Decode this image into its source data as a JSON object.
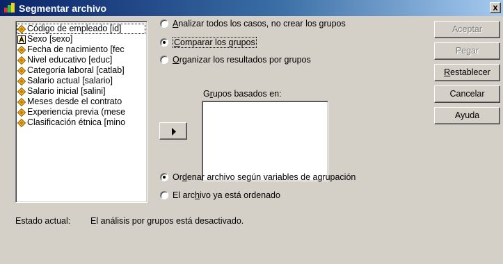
{
  "window": {
    "title": "Segmentar archivo",
    "close_label": "x"
  },
  "variables": [
    {
      "label": "Código de empleado [id]",
      "icon": "scale-variable-icon",
      "selected": true
    },
    {
      "label": "Sexo [sexo]",
      "icon": "nominal-string-variable-icon"
    },
    {
      "label": "Fecha de nacimiento [fec",
      "icon": "scale-variable-icon"
    },
    {
      "label": "Nivel educativo [educ]",
      "icon": "scale-variable-icon"
    },
    {
      "label": "Categoría laboral [catlab]",
      "icon": "scale-variable-icon"
    },
    {
      "label": "Salario actual [salario]",
      "icon": "scale-variable-icon"
    },
    {
      "label": "Salario inicial [salini]",
      "icon": "scale-variable-icon"
    },
    {
      "label": "Meses desde el contrato",
      "icon": "scale-variable-icon"
    },
    {
      "label": "Experiencia previa (mese",
      "icon": "scale-variable-icon"
    },
    {
      "label": "Clasificación étnica [mino",
      "icon": "scale-variable-icon"
    }
  ],
  "analysis_options": [
    {
      "accel": "A",
      "rest": "nalizar todos los casos, no crear los grupos",
      "checked": false
    },
    {
      "accel": "C",
      "rest": "omparar los grupos",
      "checked": true
    },
    {
      "accel": "O",
      "rest": "rganizar los resultados por grupos",
      "checked": false
    }
  ],
  "groups": {
    "label_pre": "G",
    "label_accel": "r",
    "label_rest": "upos basados en:"
  },
  "sort_options": [
    {
      "pre": "Or",
      "accel": "d",
      "rest": "enar archivo según variables de agrupación",
      "checked": true
    },
    {
      "pre": "El arc",
      "accel": "h",
      "rest": "ivo ya está ordenado",
      "checked": false
    }
  ],
  "buttons": {
    "accept": "Aceptar",
    "paste": "Pegar",
    "reset_accel": "R",
    "reset_rest": "establecer",
    "cancel": "Cancelar",
    "help": "Ayuda"
  },
  "status": {
    "label": "Estado actual:",
    "text": "El análisis por grupos está desactivado."
  }
}
